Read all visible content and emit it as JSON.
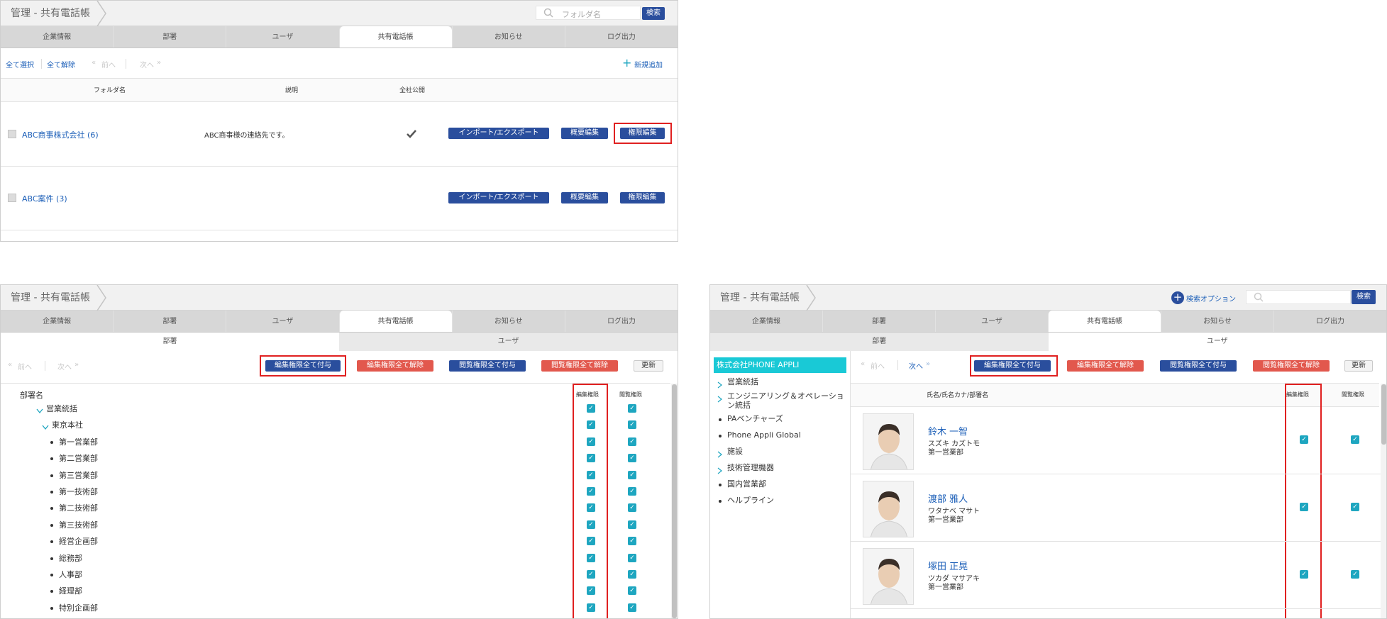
{
  "breadcrumb": "管理 - 共有電話帳",
  "main_tabs": [
    "企業情報",
    "部署",
    "ユーザ",
    "共有電話帳",
    "お知らせ",
    "ログ出力"
  ],
  "panel1": {
    "search_placeholder": "フォルダ名",
    "search_button": "検索",
    "select_all": "全て選択",
    "deselect_all": "全て解除",
    "prev": "前へ",
    "next": "次へ",
    "add_new": "新規追加",
    "columns": {
      "folder": "フォルダ名",
      "desc": "説明",
      "public": "全社公開"
    },
    "rows": [
      {
        "name": "ABC商事株式会社 (6)",
        "desc": "ABC商事様の連絡先です。",
        "public_icon": "check-icon"
      },
      {
        "name": "ABC案件 (3)",
        "desc": "",
        "public_icon": ""
      }
    ],
    "btn_import": "インポート/エクスポート",
    "btn_summary": "概要編集",
    "btn_perm": "権限編集"
  },
  "perm_tabs": [
    "部署",
    "ユーザ"
  ],
  "actions": {
    "grant_edit": "編集権限全て付与",
    "revoke_edit": "編集権限全て解除",
    "grant_view": "閲覧権限全て付与",
    "revoke_view": "閲覧権限全て解除",
    "refresh": "更新"
  },
  "panel2": {
    "col_dept": "部署名",
    "col_edit": "編集権限",
    "col_view": "閲覧権限",
    "tree": [
      {
        "label": "営業統括",
        "level": 1,
        "icon": "chevron-down-icon"
      },
      {
        "label": "東京本社",
        "level": 2,
        "icon": "chevron-down-icon"
      },
      {
        "label": "第一営業部",
        "level": 3,
        "icon": "bullet"
      },
      {
        "label": "第二営業部",
        "level": 3,
        "icon": "bullet"
      },
      {
        "label": "第三営業部",
        "level": 3,
        "icon": "bullet"
      },
      {
        "label": "第一技術部",
        "level": 3,
        "icon": "bullet"
      },
      {
        "label": "第二技術部",
        "level": 3,
        "icon": "bullet"
      },
      {
        "label": "第三技術部",
        "level": 3,
        "icon": "bullet"
      },
      {
        "label": "経営企画部",
        "level": 3,
        "icon": "bullet"
      },
      {
        "label": "総務部",
        "level": 3,
        "icon": "bullet"
      },
      {
        "label": "人事部",
        "level": 3,
        "icon": "bullet"
      },
      {
        "label": "経理部",
        "level": 3,
        "icon": "bullet"
      },
      {
        "label": "特別企画部",
        "level": 3,
        "icon": "bullet"
      }
    ]
  },
  "panel3": {
    "search_options": "検索オプション",
    "search_button": "検索",
    "company": "株式会社PHONE APPLI",
    "sidebar": [
      {
        "label": "営業統括",
        "icon": "chevron-right-icon"
      },
      {
        "label": "エンジニアリング＆オペレーション統括",
        "icon": "chevron-right-icon"
      },
      {
        "label": "PAベンチャーズ",
        "icon": "bullet"
      },
      {
        "label": "Phone Appli Global",
        "icon": "bullet"
      },
      {
        "label": "施設",
        "icon": "chevron-right-icon"
      },
      {
        "label": "技術管理機器",
        "icon": "chevron-right-icon"
      },
      {
        "label": "国内営業部",
        "icon": "bullet"
      },
      {
        "label": "ヘルプライン",
        "icon": "bullet"
      }
    ],
    "col_name": "氏名/氏名カナ/部署名",
    "col_edit": "編集権限",
    "col_view": "閲覧権限",
    "users": [
      {
        "name": "鈴木 一智",
        "kana": "スズキ カズトモ",
        "dept": "第一営業部"
      },
      {
        "name": "渡部 雅人",
        "kana": "ワタナベ マサト",
        "dept": "第一営業部"
      },
      {
        "name": "塚田 正晃",
        "kana": "ツカダ マサアキ",
        "dept": "第一営業部"
      }
    ]
  },
  "colors": {
    "accent": "#2a4e9d",
    "danger": "#e2584d",
    "check": "#1ea6c0",
    "company": "#19c9d6",
    "highlight": "#e02020"
  }
}
